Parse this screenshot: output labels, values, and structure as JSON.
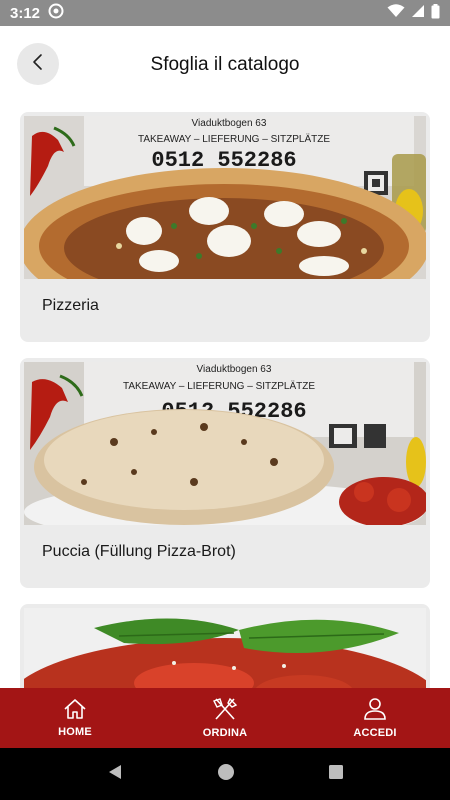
{
  "status_bar": {
    "time": "3:12"
  },
  "header": {
    "title": "Sfoglia il catalogo"
  },
  "catalog": {
    "items": [
      {
        "label": "Pizzeria",
        "sign_address": "Viaduktbogen 63",
        "sign_services": "TAKEAWAY – LIEFERUNG – SITZPLÄTZE",
        "sign_phone": "0512 552286"
      },
      {
        "label": "Puccia (Füllung Pizza-Brot)",
        "sign_address": "Viaduktbogen 63",
        "sign_services": "TAKEAWAY – LIEFERUNG – SITZPLÄTZE",
        "sign_phone": "0512 552286"
      },
      {
        "label": ""
      }
    ]
  },
  "bottom_nav": {
    "home_label": "HOME",
    "ordina_label": "ORDINA",
    "accedi_label": "ACCEDI"
  },
  "colors": {
    "brand": "#a31515",
    "card_bg": "#ebebeb",
    "status_bar": "#8c8c8c"
  }
}
